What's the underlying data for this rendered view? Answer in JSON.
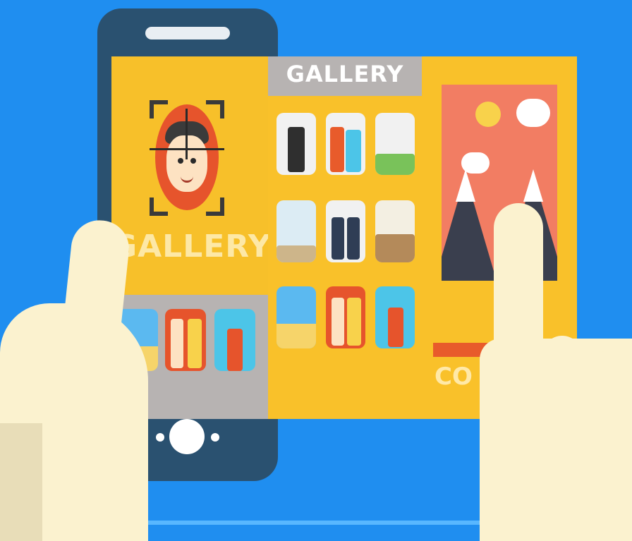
{
  "titles": {
    "phone_screen": "GALLERY",
    "middle_panel": "GALLERY",
    "right_panel_partial": "CO"
  },
  "icons": {
    "face_scan": "face-scan-icon",
    "photo": "landscape-photo-icon"
  },
  "colors": {
    "background": "#1f8ef0",
    "panel": "#f9c12a",
    "header_gray": "#b7b3b2",
    "phone_body": "#2a5170",
    "accent_red": "#e85b2b"
  }
}
